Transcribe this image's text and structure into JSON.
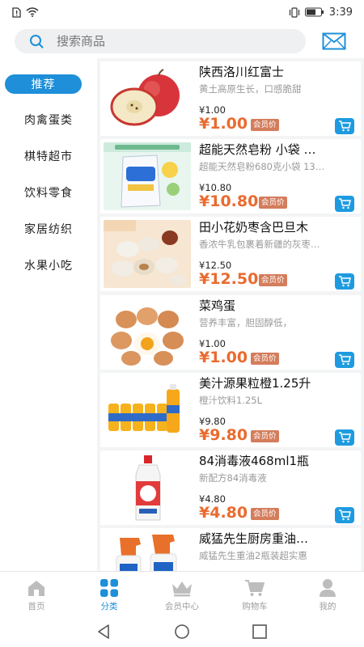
{
  "status_bar": {
    "time": "3:39",
    "signal_icon": "alert-sim-icon",
    "wifi_icon": "wifi-icon",
    "vibrate_icon": "vibrate-icon",
    "battery_icon": "battery-icon"
  },
  "search": {
    "placeholder": "搜索商品",
    "icon": "search-icon",
    "mail_icon": "mail-icon"
  },
  "colors": {
    "accent": "#1e8fd8",
    "price": "#e96b2f",
    "badge": "#d47d5c"
  },
  "sidebar": {
    "items": [
      {
        "label": "推荐",
        "active": true
      },
      {
        "label": "肉禽蛋类",
        "active": false
      },
      {
        "label": "棋特超市",
        "active": false
      },
      {
        "label": "饮料零食",
        "active": false
      },
      {
        "label": "家居纺织",
        "active": false
      },
      {
        "label": "水果小吃",
        "active": false
      }
    ]
  },
  "products": [
    {
      "title": "陕西洛川红富士",
      "subtitle": "黄土高原生长，口感脆甜",
      "price": "¥1.00",
      "member_price": "¥1.00",
      "badge": "会员价",
      "image": "apple"
    },
    {
      "title": "超能天然皂粉 小袋 …",
      "subtitle": "超能天然皂粉680克小袋 13…",
      "price": "¥10.80",
      "member_price": "¥10.80",
      "badge": "会员价",
      "image": "soap-powder"
    },
    {
      "title": "田小花奶枣含巴旦木",
      "subtitle": "香浓牛乳包裹着新疆的灰枣…",
      "price": "¥12.50",
      "member_price": "¥12.50",
      "badge": "会员价",
      "image": "milk-dates"
    },
    {
      "title": "菜鸡蛋",
      "subtitle": "营养丰富，胆固醇低，",
      "price": "¥1.00",
      "member_price": "¥1.00",
      "badge": "会员价",
      "image": "eggs"
    },
    {
      "title": "美汁源果粒橙1.25升",
      "subtitle": "橙汁饮料1.25L",
      "price": "¥9.80",
      "member_price": "¥9.80",
      "badge": "会员价",
      "image": "orange-juice"
    },
    {
      "title": "84消毒液468ml1瓶",
      "subtitle": "新配方84消毒液",
      "price": "¥4.80",
      "member_price": "¥4.80",
      "badge": "会员价",
      "image": "disinfectant"
    },
    {
      "title": "威猛先生厨房重油…",
      "subtitle": "威猛先生重油2瓶装超实惠",
      "image": "kitchen-cleaner"
    }
  ],
  "bottom_nav": {
    "items": [
      {
        "label": "首页",
        "icon": "home-icon",
        "active": false
      },
      {
        "label": "分类",
        "icon": "category-icon",
        "active": true
      },
      {
        "label": "会员中心",
        "icon": "crown-icon",
        "active": false
      },
      {
        "label": "购物车",
        "icon": "cart-icon",
        "active": false
      },
      {
        "label": "我的",
        "icon": "user-icon",
        "active": false
      }
    ]
  }
}
